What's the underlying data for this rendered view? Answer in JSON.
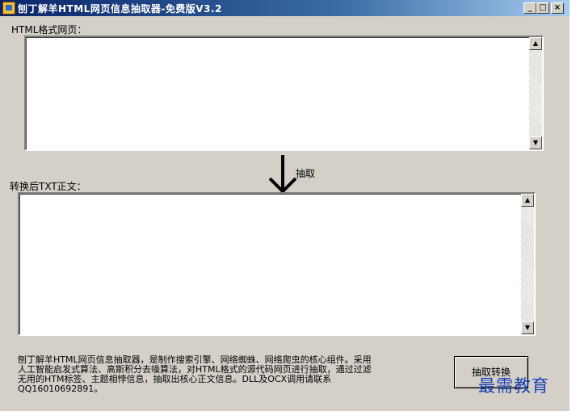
{
  "window": {
    "title": "刨丁解羊HTML网页信息抽取器-免费版V3.2",
    "minimize": "_",
    "maximize": "□",
    "close": "×"
  },
  "html_label": "HTML格式网页：",
  "html_input_value": "",
  "arrow_label": "抽取",
  "txt_label": "转换后TXT正文：",
  "txt_output_value": "",
  "description": "刨丁解羊HTML网页信息抽取器，是制作搜索引擎、网络蜘蛛、网络爬虫的核心组件。采用\n人工智能启发式算法、高斯积分去噪算法，对HTML格式的源代码网页进行抽取，通过过滤\n无用的HTM标签、主题相悖信息，抽取出核心正文信息。DLL及OCX调用请联系\nQQ16010692891。",
  "extract_button": "抽取转换",
  "watermark": "最需教育"
}
